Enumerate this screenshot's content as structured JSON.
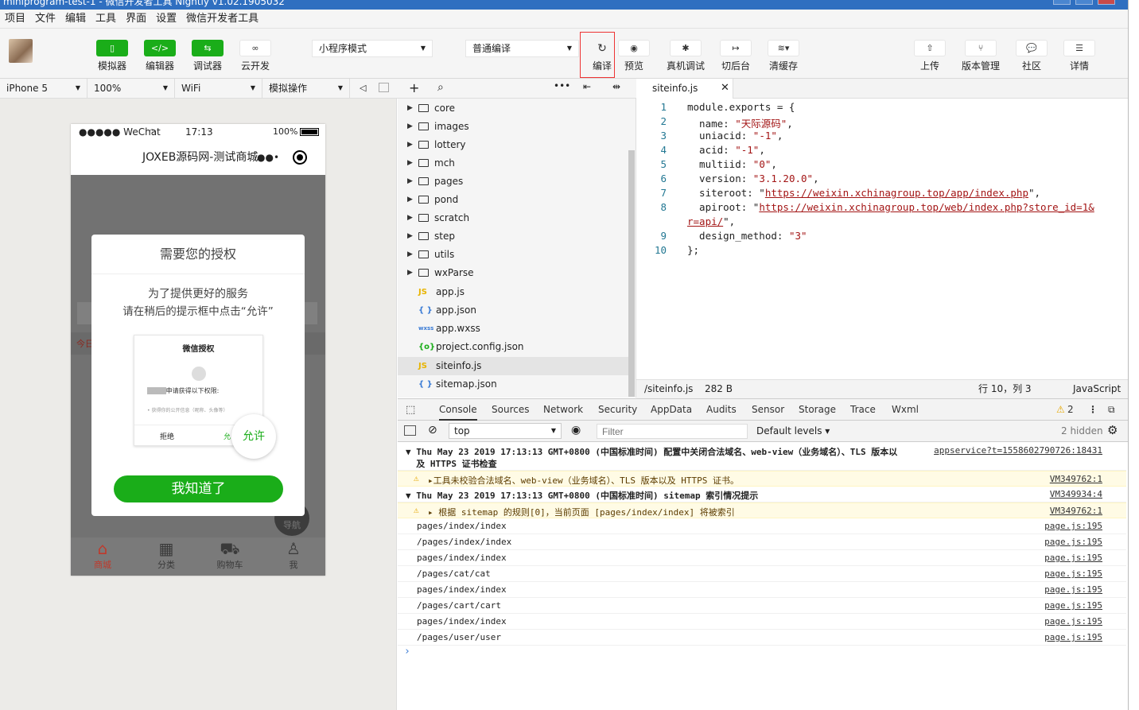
{
  "titlebar": {
    "text": "miniprogram-test-1 - 微信开发者工具 Nightly v1.02.1905032"
  },
  "menu": [
    "项目",
    "文件",
    "编辑",
    "工具",
    "界面",
    "设置",
    "微信开发者工具"
  ],
  "toolbar": {
    "simulator": "模拟器",
    "editor": "编辑器",
    "debugger": "调试器",
    "cloud": "云开发",
    "mode_select": "小程序模式",
    "compile_select": "普通编译",
    "compile": "编译",
    "preview": "预览",
    "remote_debug": "真机调试",
    "background": "切后台",
    "clear_cache": "清缓存",
    "upload": "上传",
    "version": "版本管理",
    "community": "社区",
    "details": "详情"
  },
  "simbar": {
    "device": "iPhone 5",
    "zoom": "100%",
    "network": "WiFi",
    "action": "模拟操作"
  },
  "phone": {
    "carrier": "●●●●● WeChat",
    "time": "17:13",
    "battery": "100%",
    "nav_title": "JOXEB源码网-测试商城",
    "side_text": "今日",
    "modal": {
      "title": "需要您的授权",
      "line1": "为了提供更好的服务",
      "line2": "请在稍后的提示框中点击“允许”",
      "card_title": "微信授权",
      "card_req": "申请获得以下权限:",
      "card_item": "• 获得你的公开信息（昵称、头像等）",
      "card_deny": "拒绝",
      "card_allow": "允",
      "allow_bubble": "允许",
      "button": "我知道了"
    },
    "nav_float": "导航",
    "tabs": [
      {
        "label": "商城"
      },
      {
        "label": "分类"
      },
      {
        "label": "购物车"
      },
      {
        "label": "我"
      }
    ],
    "tab_colors": {
      "active": "#c0392b",
      "inactive": "#3a3a3a"
    }
  },
  "tree": {
    "folders": [
      "core",
      "images",
      "lottery",
      "mch",
      "pages",
      "pond",
      "scratch",
      "step",
      "utils",
      "wxParse"
    ],
    "files": [
      {
        "type": "JS",
        "name": "app.js"
      },
      {
        "type": "{ }",
        "name": "app.json"
      },
      {
        "type": "wxss",
        "name": "app.wxss"
      },
      {
        "type": "{o}",
        "name": "project.config.json"
      },
      {
        "type": "JS",
        "name": "siteinfo.js"
      },
      {
        "type": "{ }",
        "name": "sitemap.json"
      }
    ]
  },
  "editor": {
    "tab": "siteinfo.js",
    "lines": [
      {
        "n": "1",
        "pre": "module.exports = {",
        "s": "",
        "post": "",
        "url": false
      },
      {
        "n": "2",
        "pre": "  name: ",
        "s": "\"天际源码\"",
        "post": ",",
        "url": false
      },
      {
        "n": "3",
        "pre": "  uniacid: ",
        "s": "\"-1\"",
        "post": ",",
        "url": false
      },
      {
        "n": "4",
        "pre": "  acid: ",
        "s": "\"-1\"",
        "post": ",",
        "url": false
      },
      {
        "n": "5",
        "pre": "  multiid: ",
        "s": "\"0\"",
        "post": ",",
        "url": false
      },
      {
        "n": "6",
        "pre": "  version: ",
        "s": "\"3.1.20.0\"",
        "post": ",",
        "url": false
      },
      {
        "n": "7",
        "pre": "  siteroot: \"",
        "s": "https://weixin.xchinagroup.top/app/index.php",
        "post": "\",",
        "url": true
      },
      {
        "n": "8",
        "pre": "  apiroot: \"",
        "s": "https://weixin.xchinagroup.top/web/index.php?store_id=1&",
        "post": "",
        "url": true
      },
      {
        "n": "",
        "pre": "",
        "s": "r=api/",
        "post": "\",",
        "url": true
      },
      {
        "n": "9",
        "pre": "  design_method: ",
        "s": "\"3\"",
        "post": "",
        "url": false
      },
      {
        "n": "10",
        "pre": "};",
        "s": "",
        "post": "",
        "url": false
      }
    ],
    "status": {
      "path": "/siteinfo.js",
      "size": "282 B",
      "pos": "行 10，列 3",
      "lang": "JavaScript"
    }
  },
  "devtools": {
    "tabs": [
      "Console",
      "Sources",
      "Network",
      "Security",
      "AppData",
      "Audits",
      "Sensor",
      "Storage",
      "Trace",
      "Wxml"
    ],
    "warn_count": "2",
    "context": "top",
    "filter_placeholder": "Filter",
    "levels": "Default levels",
    "hidden": "2 hidden",
    "rows": [
      {
        "kind": "group",
        "text": "▼ Thu May 23 2019 17:13:13 GMT+0800 (中国标准时间) 配置中关闭合法域名、web-view（业务域名）、TLS 版本以",
        "text2": "  及 HTTPS 证书检查",
        "src": "appservice?t=1558602790726:18431"
      },
      {
        "kind": "warn",
        "text": "▸工具未校验合法域名、web-view（业务域名）、TLS 版本以及 HTTPS 证书。",
        "src": "VM349762:1"
      },
      {
        "kind": "group",
        "text": "▼ Thu May 23 2019 17:13:13 GMT+0800 (中国标准时间) sitemap 索引情况提示",
        "text2": "",
        "src": "VM349934:4"
      },
      {
        "kind": "warn",
        "text": "▸ 根据 sitemap 的规则[0]，当前页面 [pages/index/index] 将被索引",
        "src": "VM349762:1"
      },
      {
        "kind": "log",
        "text": "pages/index/index",
        "src": "page.js:195"
      },
      {
        "kind": "log",
        "text": "/pages/index/index",
        "src": "page.js:195"
      },
      {
        "kind": "log",
        "text": "pages/index/index",
        "src": "page.js:195"
      },
      {
        "kind": "log",
        "text": "/pages/cat/cat",
        "src": "page.js:195"
      },
      {
        "kind": "log",
        "text": "pages/index/index",
        "src": "page.js:195"
      },
      {
        "kind": "log",
        "text": "/pages/cart/cart",
        "src": "page.js:195"
      },
      {
        "kind": "log",
        "text": "pages/index/index",
        "src": "page.js:195"
      },
      {
        "kind": "log",
        "text": "/pages/user/user",
        "src": "page.js:195"
      }
    ],
    "prompt": "›"
  },
  "colors": {
    "green": "#1aad19",
    "highlight": "#e33333",
    "warn_bg": "#fffbe5"
  }
}
